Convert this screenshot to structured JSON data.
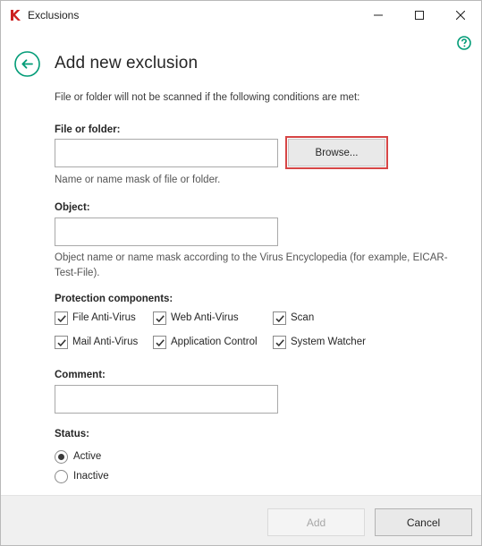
{
  "window": {
    "title": "Exclusions",
    "controls": {
      "minimize": "minimize-icon",
      "maximize": "maximize-icon",
      "close": "close-icon"
    }
  },
  "header": {
    "title": "Add new exclusion",
    "description": "File or folder will not be scanned if the following conditions are met:"
  },
  "file_or_folder": {
    "label": "File or folder:",
    "value": "",
    "browse_label": "Browse...",
    "hint": "Name or name mask of file or folder."
  },
  "object": {
    "label": "Object:",
    "value": "",
    "hint_line1": "Object name or name mask according to the Virus Encyclopedia (for example, EICAR-",
    "hint_line2": "Test-File)."
  },
  "protection": {
    "label": "Protection components:",
    "items": [
      {
        "label": "File Anti-Virus",
        "checked": true
      },
      {
        "label": "Web Anti-Virus",
        "checked": true
      },
      {
        "label": "Scan",
        "checked": true
      },
      {
        "label": "Mail Anti-Virus",
        "checked": true
      },
      {
        "label": "Application Control",
        "checked": true
      },
      {
        "label": "System Watcher",
        "checked": true
      }
    ]
  },
  "comment": {
    "label": "Comment:",
    "value": ""
  },
  "status": {
    "label": "Status:",
    "options": [
      {
        "label": "Active",
        "selected": true
      },
      {
        "label": "Inactive",
        "selected": false
      }
    ]
  },
  "footer": {
    "add_label": "Add",
    "cancel_label": "Cancel",
    "add_enabled": false
  },
  "colors": {
    "accent": "#009b76",
    "highlight": "#d64545",
    "logo": "#cc1f1f"
  }
}
